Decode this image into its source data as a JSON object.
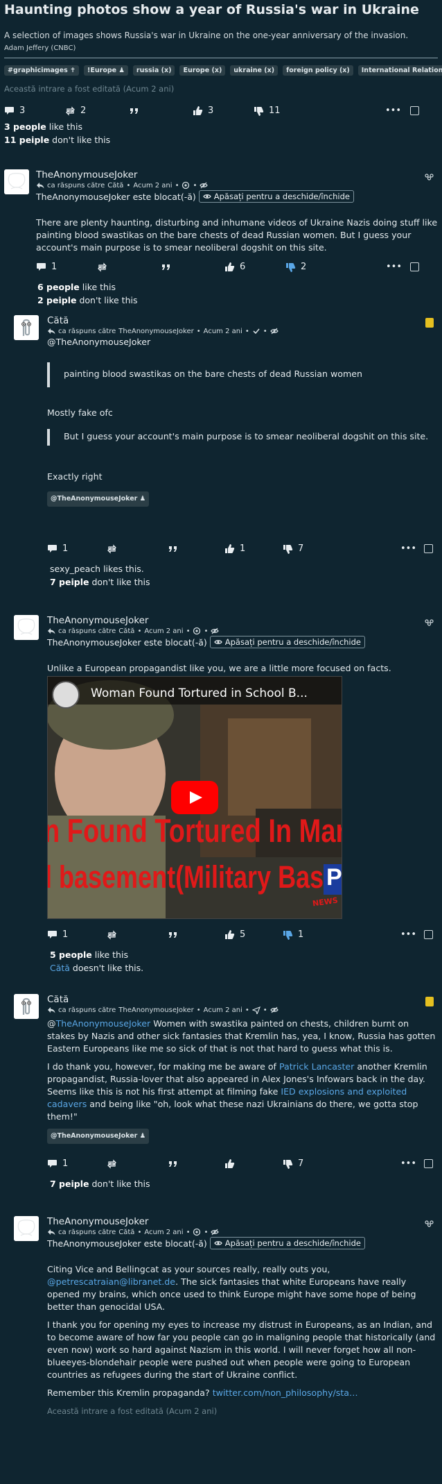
{
  "post": {
    "title": "Haunting photos show a year of Russia's war in Ukraine",
    "summary": "A selection of images shows Russia's war in Ukraine on the one-year anniversary of the invasion.",
    "byline": "Adam Jeffery (CNBC)",
    "tags": [
      "#graphicimages ✝",
      "!Europe ♟",
      "russia (x)",
      "Europe (x)",
      "ukraine (x)",
      "foreign policy (x)",
      "International Relations (x)"
    ],
    "edited": "Această intrare a fost editată (Acum 2 ani)",
    "comments_count": "3",
    "boosts_count": "2",
    "likes_count": "3",
    "dislikes_count": "11",
    "likes_line_count": "3 people",
    "likes_line_text": " like this",
    "dislikes_line_count": "11 peiple",
    "dislikes_line_text": " don't like this"
  },
  "labels": {
    "reply_to": "ca răspuns către",
    "blocked_suffix": "este blocat(-ă)",
    "toggle": "Apăsați pentru a deschide/închide",
    "ago": "Acum 2 ani",
    "more": "•••"
  },
  "comments": [
    {
      "author": "TheAnonymouseJoker",
      "reply_to": "Cătă",
      "blocked": "TheAnonymouseJoker este blocat(-ă)",
      "text1": "There are plenty haunting, disturbing and inhumane videos of Ukraine Nazis doing stuff like painting blood swastikas on the bare chests of dead Russian women. But I guess your account's main purpose is to smear neoliberal dogshit on this site.",
      "comments": "1",
      "likes": "6",
      "dislikes": "2",
      "likes_line_count": "6 people",
      "likes_line_text": " like this",
      "dislikes_line_count": "2 peiple",
      "dislikes_line_text": " don't like this"
    },
    {
      "author": "Cătă",
      "reply_to": "TheAnonymouseJoker",
      "mention": "@TheAnonymouseJoker",
      "quote1": "painting blood swastikas on the bare chests of dead Russian women",
      "text1": "Mostly fake ofc",
      "quote2": "But I guess your account's main purpose is to smear neoliberal dogshit on this site.",
      "text2": "Exactly right",
      "tag": "@TheAnonymouseJoker ♟",
      "comments": "1",
      "likes": "1",
      "dislikes": "7",
      "likes_line_text": "sexy_peach likes this.",
      "dislikes_line_count": "7 peiple",
      "dislikes_line_text": " don't like this"
    },
    {
      "author": "TheAnonymouseJoker",
      "reply_to": "Cătă",
      "blocked": "TheAnonymouseJoker este blocat(-ă)",
      "text1": "Unlike a European propagandist like you, we are a little more focused on facts.",
      "video_title": "Woman Found Tortured in School B...",
      "video_line1": "n Found Tortured In Mariupol",
      "video_line2": "l basement(Military Base)",
      "video_brand": "P",
      "video_news": "NEWS",
      "comments": "1",
      "likes": "5",
      "dislikes": "1",
      "likes_line_count": "5 people",
      "likes_line_text": " like this",
      "dislikes_line_name": "Cătă",
      "dislikes_line_text": " doesn't like this."
    },
    {
      "author": "Cătă",
      "reply_to": "TheAnonymouseJoker",
      "mention": "@",
      "mention_link": "TheAnonymouseJoker",
      "text1": " Women with swastika painted on chests, children burnt on stakes by Nazis and other sick fantasies that Kremlin has, yea, I know, Russia has gotten Eastern Europeans like me so sick of that is not that hard to guess what this is.",
      "text2a": "I do thank you, however, for making me be aware of ",
      "link1": "Patrick Lancaster",
      "text2b": " another Kremlin propagandist, Russia-lover that also appeared in Alex Jones's Infowars back in the day. Seems like this is not his first attempt at filming fake ",
      "link2": "IED explosions and exploited cadavers",
      "text2c": " and being like \"oh, look what these nazi Ukrainians do there, we gotta stop them!\"",
      "tag": "@TheAnonymouseJoker ♟",
      "comments": "1",
      "likes": "",
      "dislikes": "7",
      "dislikes_line_count": "7 peiple",
      "dislikes_line_text": " don't like this"
    },
    {
      "author": "TheAnonymouseJoker",
      "reply_to": "Cătă",
      "blocked": "TheAnonymouseJoker este blocat(-ă)",
      "text1a": "Citing Vice and Bellingcat as your sources really, really outs you, ",
      "link1": "@petrescatraian@libranet.de",
      "text1b": ". The sick fantasies that white Europeans have really opened my brains, which once used to think Europe might have some hope of being better than genocidal USA.",
      "text2": "I thank you for opening my eyes to increase my distrust in Europeans, as an Indian, and to become aware of how far you people can go in maligning people that historically (and even now) work so hard against Nazism in this world. I will never forget how all non-blueeyes-blondehair people were pushed out when people were going to European countries as refugees during the start of Ukraine conflict.",
      "text3": "Remember this Kremlin propaganda? ",
      "link2": "twitter.com/non_philosophy/sta…",
      "edited": "Această intrare a fost editată (Acum 2 ani)"
    }
  ]
}
